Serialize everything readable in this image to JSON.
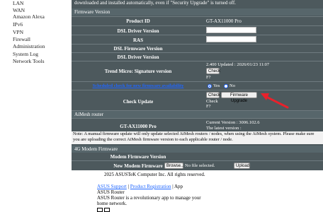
{
  "sidebar": {
    "items": [
      "LAN",
      "WAN",
      "Amazon Alexa",
      "IPv6",
      "VPN",
      "Firewall",
      "Administration",
      "System Log",
      "Network Tools"
    ]
  },
  "top_text": "downloaded and installed automatically, even if \"Security Upgrade\" is turned off.",
  "firmware_version_section": "Firmware Version",
  "rows": {
    "product_id": {
      "label": "Product ID",
      "value": "GT-AX11000 Pro"
    },
    "dsl_driver": {
      "label": "DSL Driver Version"
    },
    "ras": {
      "label": "RAS"
    },
    "dsl_fw": {
      "label": "DSL Firmware Version"
    },
    "dsl_driver2": {
      "label": "DSL Driver Version"
    },
    "trend_micro": {
      "label": "Trend Micro: Signature version",
      "value": "2.400  Updated : 2026/01/23 11:07",
      "check_label": "Check",
      "suffix": "F?"
    },
    "scheduled": {
      "label": "Scheduled check for new firmware availability",
      "yes": "Yes",
      "no": "No",
      "selected": "Yes"
    },
    "check_update": {
      "label": "Check Update",
      "check_label": "Check",
      "upgrade_label": "Firmware Upgrade",
      "status1": "Check",
      "status2": "F?"
    }
  },
  "aimesh": {
    "section": "AiMesh router",
    "model": "GT-AX11000 Pro",
    "current": "Current Version : 3006.102.6",
    "latest": "The latest version :"
  },
  "note_text": "Note: A manual firmware update will only update selected AiMesh routers / nodes, when using the AiMesh system. Please make sure you are uploading the correct AiMesh firmware version to each applicable router / node.",
  "fourg": {
    "section": "4G Modem Firmware",
    "modem_version_label": "Modem Firmware Version",
    "new_modem_label": "New Modem Firmware",
    "browse": "Browse...",
    "no_file": "No file selected.",
    "upload": "Upload"
  },
  "footer": {
    "copyright": "2025 ASUSTeK Computer Inc. All rights reserved.",
    "support": "ASUS Support",
    "product_reg": "Product Registration",
    "app": " | App",
    "asus_router": "ASUS Router",
    "description": "ASUS Router is a revolutionary app to manage your",
    "description2": "home network."
  },
  "colors": {
    "panel": "#4d595d",
    "accent": "#1f66ff",
    "arrow": "#e8212b"
  }
}
